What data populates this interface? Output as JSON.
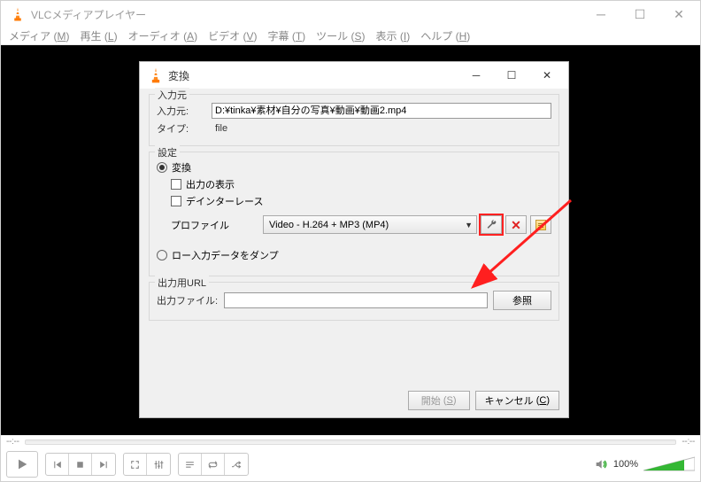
{
  "window": {
    "title": "VLCメディアプレイヤー"
  },
  "menubar": {
    "items": [
      {
        "label": "メディア",
        "accel": "M"
      },
      {
        "label": "再生",
        "accel": "L"
      },
      {
        "label": "オーディオ",
        "accel": "A"
      },
      {
        "label": "ビデオ",
        "accel": "V"
      },
      {
        "label": "字幕",
        "accel": "T"
      },
      {
        "label": "ツール",
        "accel": "S"
      },
      {
        "label": "表示",
        "accel": "I"
      },
      {
        "label": "ヘルプ",
        "accel": "H"
      }
    ]
  },
  "seek": {
    "time_left": "--:--",
    "time_right": "--:--"
  },
  "volume": {
    "percent": "100%"
  },
  "dialog": {
    "title": "変換",
    "source_group": {
      "legend": "入力元",
      "source_label": "入力元:",
      "source_path": "D:¥tinka¥素材¥自分の写真¥動画¥動画2.mp4",
      "type_label": "タイプ:",
      "type_value": "file"
    },
    "settings_group": {
      "legend": "設定",
      "radio_convert": "変換",
      "checkbox_display": "出力の表示",
      "checkbox_deinterlace": "デインターレース",
      "profile_label": "プロファイル",
      "profile_value": "Video - H.264 + MP3 (MP4)",
      "radio_dump": "ロー入力データをダンプ"
    },
    "output_group": {
      "legend": "出力用URL",
      "output_label": "出力ファイル:",
      "output_value": "",
      "browse_label": "参照"
    },
    "buttons": {
      "start_label": "開始",
      "start_accel": "S",
      "cancel_label": "キャンセル",
      "cancel_accel": "C"
    }
  }
}
